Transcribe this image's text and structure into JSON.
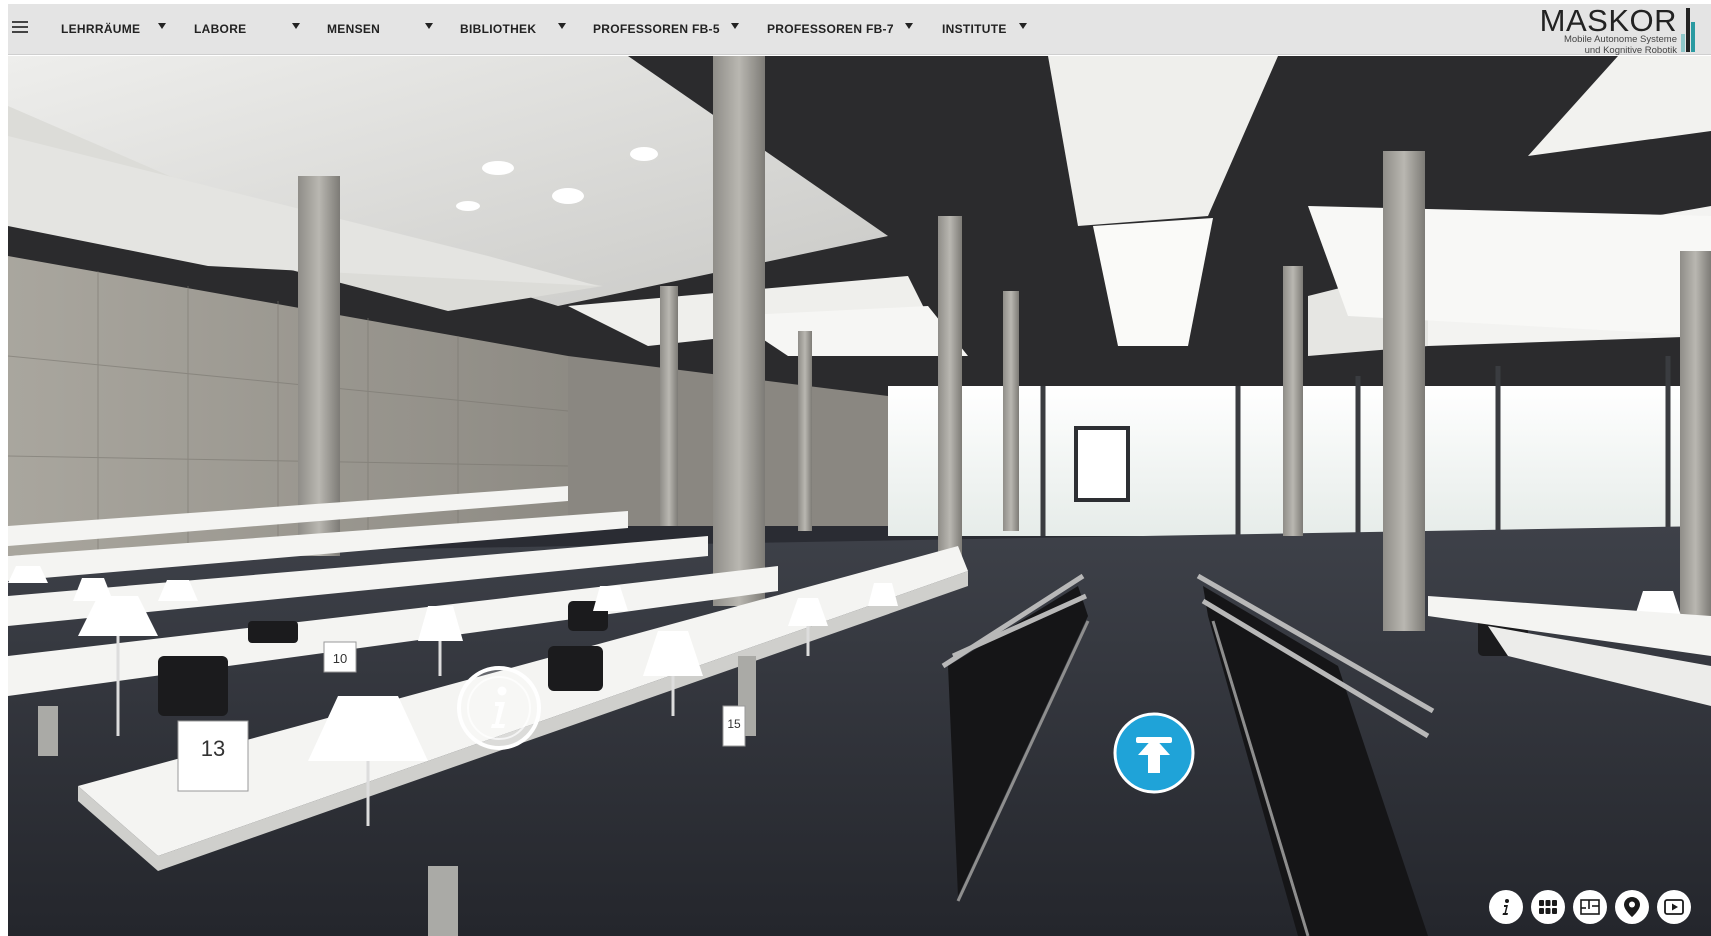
{
  "menu": {
    "items": [
      {
        "label": "LEHRRÄUME"
      },
      {
        "label": "LABORE"
      },
      {
        "label": "MENSEN"
      },
      {
        "label": "BIBLIOTHEK"
      },
      {
        "label": "PROFESSOREN FB-5"
      },
      {
        "label": "PROFESSOREN FB-7"
      },
      {
        "label": "INSTITUTE"
      }
    ]
  },
  "logo": {
    "title": "MASKOR",
    "line1": "Mobile Autonome Systeme",
    "line2": "und Kognitive Robotik",
    "bar_colors": [
      "#8fc7c9",
      "#222222",
      "#2a9aa1"
    ]
  },
  "scene": {
    "desk_numbers": {
      "desk_a": "10",
      "desk_b": "13",
      "desk_c": "15"
    }
  },
  "hotspots": {
    "info_icon": "info-icon",
    "move_icon": "arrow-up-icon",
    "accent": "#1fa3d8"
  },
  "controls": [
    {
      "icon": "info-icon"
    },
    {
      "icon": "grid-icon"
    },
    {
      "icon": "floorplan-icon"
    },
    {
      "icon": "map-pin-icon"
    },
    {
      "icon": "play-icon"
    }
  ]
}
